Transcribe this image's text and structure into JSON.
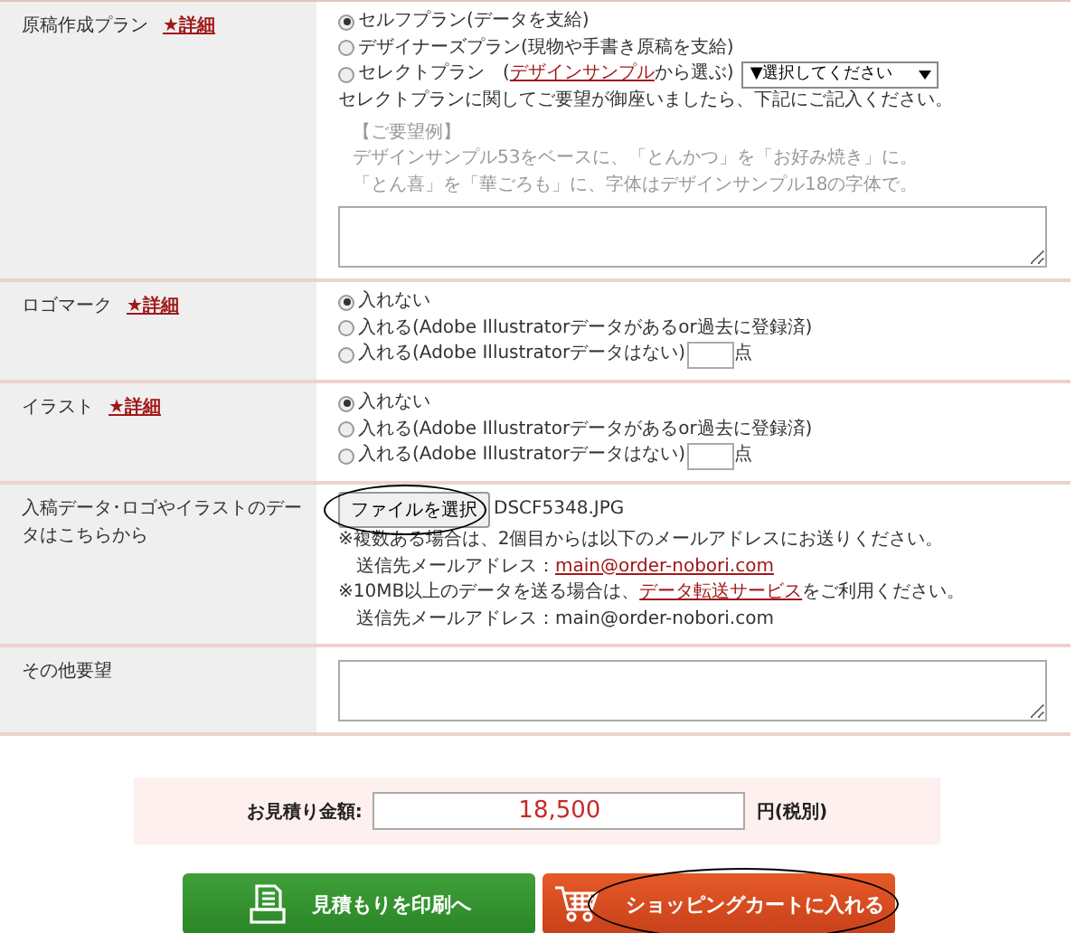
{
  "rows": [
    {
      "kind": "plan",
      "label": "原稿作成プラン",
      "detail": "★詳細",
      "options": [
        {
          "label": "セルフプラン(データを支給)",
          "selected": true
        },
        {
          "label": "デザイナーズプラン(現物や手書き原稿を支給)",
          "selected": false
        },
        {
          "label": "セレクトプラン　(",
          "link": "デザインサンプル",
          "after": "から選ぶ)",
          "select": "▼選択してください",
          "selected": false
        }
      ],
      "note": "セレクトプランに関してご要望が御座いましたら、下記にご記入ください。",
      "example": [
        "【ご要望例】",
        "デザインサンプル53をベースに、「とんかつ」を「お好み焼き」に。",
        "「とん喜」を「華ごろも」に、字体はデザインサンプル18の字体で。"
      ]
    },
    {
      "kind": "radios",
      "label": "ロゴマーク",
      "detail": "★詳細",
      "options": [
        {
          "label": "入れない",
          "selected": true
        },
        {
          "label": "入れる(Adobe Illustratorデータがあるor過去に登録済)",
          "selected": false
        },
        {
          "label": "入れる(Adobe Illustratorデータはない)",
          "unit": "点",
          "selected": false
        }
      ]
    },
    {
      "kind": "radios",
      "label": "イラスト",
      "detail": "★詳細",
      "options": [
        {
          "label": "入れない",
          "selected": true
        },
        {
          "label": "入れる(Adobe Illustratorデータがあるor過去に登録済)",
          "selected": false
        },
        {
          "label": "入れる(Adobe Illustratorデータはない)",
          "unit": "点",
          "selected": false
        }
      ]
    },
    {
      "kind": "file",
      "label": "入稿データ･ロゴやイラストのデータはこちらから",
      "button": "ファイルを選択",
      "circled": true,
      "filename": "DSCF5348.JPG",
      "lines": [
        {
          "text": "※複数ある場合は、2個目からは以下のメールアドレスにお送りください。",
          "children": [
            {
              "text": "送信先メールアドレス：",
              "link": "main@order-nobori.com"
            }
          ]
        },
        {
          "text": "※10MB以上のデータを送る場合は、",
          "link": "データ転送サービス",
          "after": "をご利用ください。",
          "children": [
            {
              "text": "送信先メールアドレス：main@order-nobori.com"
            }
          ]
        }
      ]
    },
    {
      "kind": "textarea",
      "label": "その他要望"
    }
  ],
  "estimate": {
    "label": "お見積り金額:",
    "value": "18,500",
    "unit": "円(税別)"
  },
  "buttons": [
    {
      "kind": "print",
      "label": "見積もりを印刷へ",
      "circled": false
    },
    {
      "kind": "cart",
      "label": "ショッピングカートに入れる",
      "circled": true
    }
  ]
}
